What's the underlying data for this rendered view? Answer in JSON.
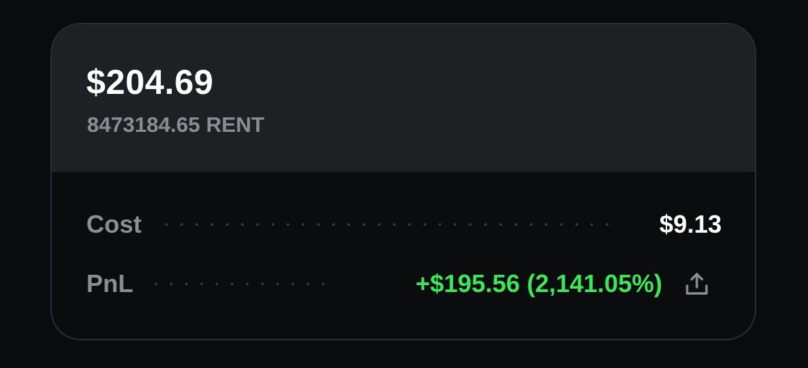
{
  "balance": {
    "usd": "$204.69",
    "token_amount": "8473184.65 RENT"
  },
  "rows": {
    "cost": {
      "label": "Cost",
      "value": "$9.13"
    },
    "pnl": {
      "label": "PnL",
      "value": "+$195.56 (2,141.05%)"
    }
  },
  "icons": {
    "share": "share-icon"
  },
  "colors": {
    "background": "#0a0b0d",
    "card_top": "#1f2024",
    "card_bottom": "#0b0c0e",
    "card_border": "#2b2d33",
    "primary_text": "#ffffff",
    "secondary_text": "#8a8d95",
    "profit": "#3ee45a"
  }
}
